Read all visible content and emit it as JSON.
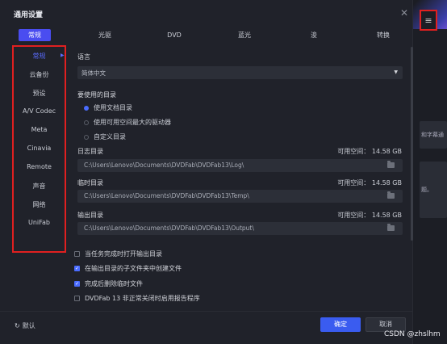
{
  "window": {
    "title": "通用设置",
    "close_glyph": "✕"
  },
  "tabs": [
    "常规",
    "光驱",
    "DVD",
    "蓝光",
    "浚",
    "转换"
  ],
  "sidebar": {
    "items": [
      "常规",
      "云备份",
      "预设",
      "A/V Codec",
      "Meta",
      "Cinavia",
      "Remote",
      "声音",
      "网络",
      "UniFab"
    ],
    "active_index": 0
  },
  "language": {
    "label": "语言",
    "value": "简体中文"
  },
  "target_dir": {
    "label": "要使用的目录",
    "options": [
      "使用文档目录",
      "使用可用空间最大的驱动器",
      "自定义目录"
    ],
    "selected_index": 0
  },
  "log_dir": {
    "label": "日志目录",
    "space": "可用空间：  14.58 GB",
    "path": "C:\\Users\\Lenovo\\Documents\\DVDFab\\DVDFab13\\Log\\"
  },
  "temp_dir": {
    "label": "临时目录",
    "space": "可用空间：  14.58 GB",
    "path": "C:\\Users\\Lenovo\\Documents\\DVDFab\\DVDFab13\\Temp\\"
  },
  "output_dir": {
    "label": "输出目录",
    "space": "可用空间：  14.58 GB",
    "path": "C:\\Users\\Lenovo\\Documents\\DVDFab\\DVDFab13\\Output\\"
  },
  "checkboxes": [
    {
      "label": "当任务完成时打开输出目录",
      "checked": false
    },
    {
      "label": "在输出目录的子文件夹中创建文件",
      "checked": true
    },
    {
      "label": "完成后删除临时文件",
      "checked": true
    },
    {
      "label": "DVDFab 13 非正常关闭时启用报告程序",
      "checked": false
    }
  ],
  "footer": {
    "reset": "默认",
    "ok": "确定",
    "cancel": "取消"
  },
  "background": {
    "menu_glyph": "≡",
    "text_1": "和字幕通",
    "text_2": "题。"
  },
  "watermark": "CSDN @zhslhm",
  "colors": {
    "accent": "#4a4df0",
    "highlight_border": "#e02020",
    "dialog_bg": "#20222a"
  }
}
